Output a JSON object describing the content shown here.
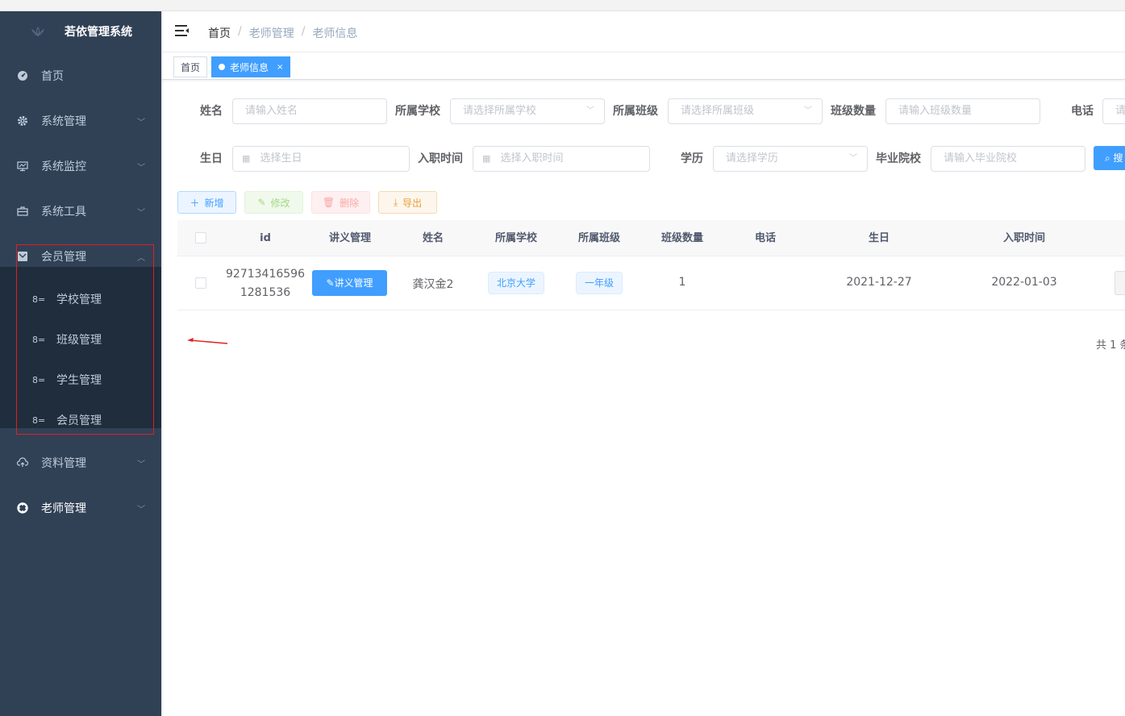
{
  "sidebar": {
    "logo_title": "若依管理系统",
    "items": [
      {
        "label": "首页",
        "icon": "dashboard-icon"
      },
      {
        "label": "系统管理",
        "icon": "gear-icon"
      },
      {
        "label": "系统监控",
        "icon": "monitor-icon"
      },
      {
        "label": "系统工具",
        "icon": "toolbox-icon"
      },
      {
        "label": "会员管理",
        "icon": "member-icon",
        "expanded": true
      },
      {
        "label": "资料管理",
        "icon": "cloud-upload-icon"
      },
      {
        "label": "老师管理",
        "icon": "lifebuoy-icon"
      }
    ],
    "submenu": [
      {
        "label": "学校管理"
      },
      {
        "label": "班级管理"
      },
      {
        "label": "学生管理"
      },
      {
        "label": "会员管理"
      }
    ]
  },
  "breadcrumb": [
    "首页",
    "老师管理",
    "老师信息"
  ],
  "tags": [
    {
      "label": "首页",
      "active": false
    },
    {
      "label": "老师信息",
      "active": true,
      "close": "×"
    }
  ],
  "search": {
    "name": {
      "label": "姓名",
      "placeholder": "请输入姓名"
    },
    "school": {
      "label": "所属学校",
      "placeholder": "请选择所属学校"
    },
    "class": {
      "label": "所属班级",
      "placeholder": "请选择所属班级"
    },
    "class_count": {
      "label": "班级数量",
      "placeholder": "请输入班级数量"
    },
    "phone": {
      "label": "电话",
      "placeholder": "请"
    },
    "birthday": {
      "label": "生日",
      "placeholder": "选择生日"
    },
    "hire_date": {
      "label": "入职时间",
      "placeholder": "选择入职时间"
    },
    "education": {
      "label": "学历",
      "placeholder": "请选择学历"
    },
    "graduate_school": {
      "label": "毕业院校",
      "placeholder": "请输入毕业院校"
    },
    "search_button": "搜"
  },
  "toolbar": {
    "add": "新增",
    "edit": "修改",
    "delete": "删除",
    "export": "导出"
  },
  "table": {
    "headers": [
      "id",
      "讲义管理",
      "姓名",
      "所属学校",
      "所属班级",
      "班级数量",
      "电话",
      "生日",
      "入职时间"
    ],
    "rows": [
      {
        "id_line1": "92713416596",
        "id_line2": "1281536",
        "handout_button": "讲义管理",
        "name": "龚汉金2",
        "school": "北京大学",
        "class": "一年级",
        "class_count": "1",
        "phone": "",
        "birthday": "2021-12-27",
        "hire_date": "2022-01-03"
      }
    ]
  },
  "pagination": {
    "total_text": "共 1 条"
  },
  "colors": {
    "sidebar_bg": "#304156",
    "submenu_bg": "#1f2d3d",
    "primary": "#409eff",
    "annotation_red": "#e02020"
  }
}
